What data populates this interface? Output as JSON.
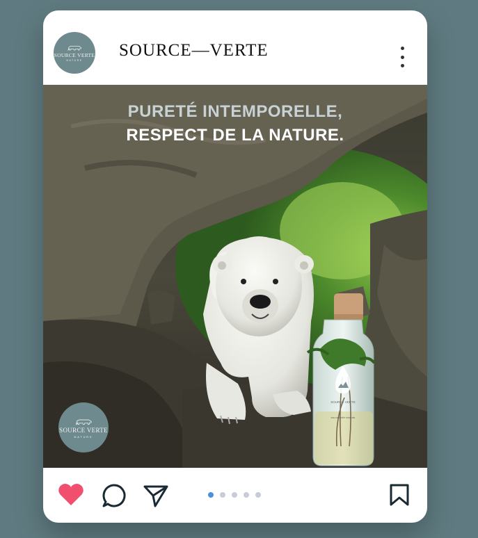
{
  "post": {
    "username": "SOURCE—VERTE",
    "avatar_brand": "SOURCE VERTE",
    "avatar_sub": "NATURE",
    "headline_line1": "PURETÉ INTEMPORELLE,",
    "headline_line2": "RESPECT DE LA NATURE.",
    "badge_brand": "SOURCE VERTE",
    "badge_sub": "NATURE",
    "bottle_label": "SOURCE VERTE",
    "bottle_text": "eau naturelle minérale",
    "carousel_total": 5,
    "carousel_active_index": 0,
    "liked": true
  },
  "colors": {
    "background": "#5f7b81",
    "brand_teal": "#6e8a8f",
    "like_red": "#f0506e",
    "dot_active": "#4a90e2",
    "dot_inactive": "#c7ccd6"
  },
  "icons": {
    "more": "more-vertical-icon",
    "like": "heart-icon",
    "comment": "comment-icon",
    "share": "send-icon",
    "save": "bookmark-icon"
  }
}
